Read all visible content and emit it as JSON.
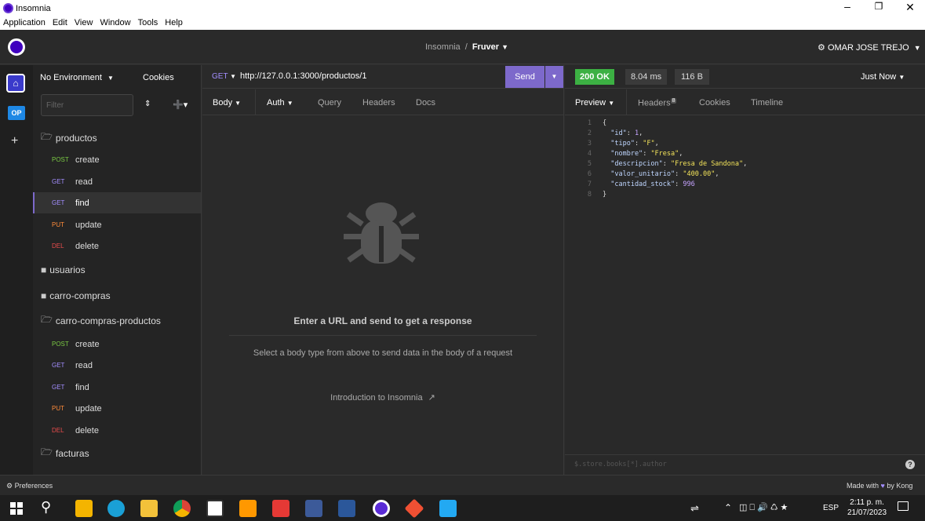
{
  "window": {
    "title": "Insomnia",
    "menu": [
      "Application",
      "Edit",
      "View",
      "Window",
      "Tools",
      "Help"
    ]
  },
  "header": {
    "project": "Insomnia",
    "separator": "/",
    "workspace": "Fruver",
    "user": "OMAR JOSE TREJO"
  },
  "rail": {
    "home_icon": "home-icon",
    "avatar": "OP",
    "add": "+"
  },
  "sidebar": {
    "environment": "No Environment",
    "cookies": "Cookies",
    "filter_placeholder": "Filter",
    "folders": [
      {
        "name": "productos",
        "items": [
          {
            "method": "POST",
            "name": "create"
          },
          {
            "method": "GET",
            "name": "read"
          },
          {
            "method": "GET",
            "name": "find"
          },
          {
            "method": "PUT",
            "name": "update"
          },
          {
            "method": "DEL",
            "name": "delete"
          }
        ]
      },
      {
        "name": "usuarios"
      },
      {
        "name": "carro-compras"
      },
      {
        "name": "carro-compras-productos",
        "items": [
          {
            "method": "POST",
            "name": "create"
          },
          {
            "method": "GET",
            "name": "read"
          },
          {
            "method": "GET",
            "name": "find"
          },
          {
            "method": "PUT",
            "name": "update"
          },
          {
            "method": "DEL",
            "name": "delete"
          }
        ]
      },
      {
        "name": "facturas"
      }
    ]
  },
  "request": {
    "method": "GET",
    "url": "http://127.0.0.1:3000/productos/1",
    "send": "Send",
    "tabs": [
      "Body",
      "Auth",
      "Query",
      "Headers",
      "Docs"
    ],
    "empty_title": "Enter a URL and send to get a response",
    "empty_hint": "Select a body type from above to send data in the body of a request",
    "intro_link": "Introduction to Insomnia"
  },
  "response": {
    "status": "200 OK",
    "time": "8.04 ms",
    "size": "116 B",
    "when": "Just Now",
    "tabs": {
      "preview": "Preview",
      "headers": "Headers",
      "headers_count": "8",
      "cookies": "Cookies",
      "timeline": "Timeline"
    },
    "lines": [
      {
        "n": "1",
        "text": "{"
      },
      {
        "n": "2",
        "key": "\"id\"",
        "val": "1",
        "type": "num",
        "comma": ","
      },
      {
        "n": "3",
        "key": "\"tipo\"",
        "val": "\"F\"",
        "type": "str",
        "comma": ","
      },
      {
        "n": "4",
        "key": "\"nombre\"",
        "val": "\"Fresa\"",
        "type": "str",
        "comma": ","
      },
      {
        "n": "5",
        "key": "\"descripcion\"",
        "val": "\"Fresa de Sandona\"",
        "type": "str",
        "comma": ","
      },
      {
        "n": "6",
        "key": "\"valor_unitario\"",
        "val": "\"400.00\"",
        "type": "str",
        "comma": ","
      },
      {
        "n": "7",
        "key": "\"cantidad_stock\"",
        "val": "996",
        "type": "num",
        "comma": ""
      },
      {
        "n": "8",
        "text": "}"
      }
    ],
    "filter_placeholder": "$.store.books[*].author"
  },
  "footer": {
    "preferences": "Preferences",
    "made_with": "Made with",
    "by": "by Kong"
  },
  "taskbar": {
    "lang": "ESP",
    "time": "2:11 p. m.",
    "date": "21/07/2023"
  },
  "colors": {
    "accent": "#7d69cb",
    "ok": "#3cb043",
    "json_key": "#bfd6ff",
    "json_str": "#f2e25a",
    "json_num": "#c5a3ff"
  }
}
